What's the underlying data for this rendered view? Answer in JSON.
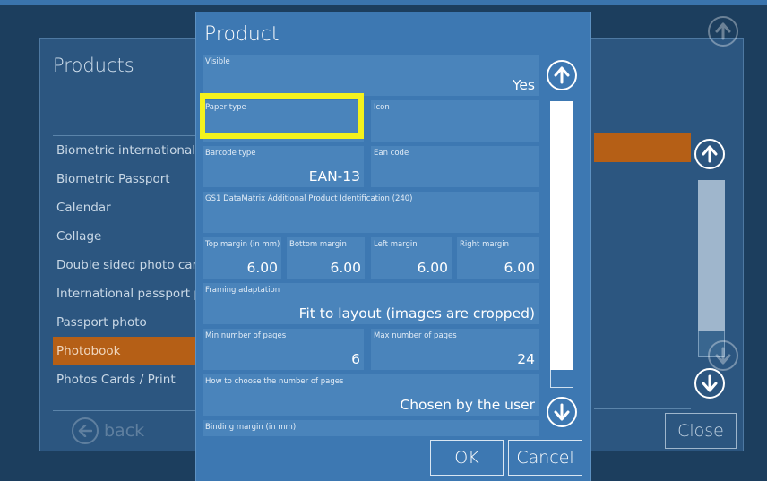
{
  "background": {
    "title": "Products",
    "items": [
      {
        "label": "Biometric international passport"
      },
      {
        "label": "Biometric Passport"
      },
      {
        "label": "Calendar"
      },
      {
        "label": "Collage"
      },
      {
        "label": "Double sided photo card"
      },
      {
        "label": "International passport photo"
      },
      {
        "label": "Passport photo"
      },
      {
        "label": "Photobook"
      },
      {
        "label": "Photos Cards / Print"
      }
    ],
    "selected_item": "Photobook",
    "close_label": "Close",
    "back_label": "back"
  },
  "dialog": {
    "title": "Product",
    "fields": {
      "visible": {
        "label": "Visible",
        "value": "Yes"
      },
      "paper_type": {
        "label": "Paper type",
        "value": ""
      },
      "icon": {
        "label": "Icon",
        "value": ""
      },
      "barcode_type": {
        "label": "Barcode type",
        "value": "EAN-13"
      },
      "ean_code": {
        "label": "Ean code",
        "value": ""
      },
      "gs1": {
        "label": "GS1 DataMatrix Additional Product Identification (240)",
        "value": ""
      },
      "top_margin": {
        "label": "Top margin (in mm)",
        "value": "6.00"
      },
      "bottom_margin": {
        "label": "Bottom margin",
        "value": "6.00"
      },
      "left_margin": {
        "label": "Left margin",
        "value": "6.00"
      },
      "right_margin": {
        "label": "Right margin",
        "value": "6.00"
      },
      "framing": {
        "label": "Framing adaptation",
        "value": "Fit to layout (images are cropped)"
      },
      "min_pages": {
        "label": "Min number of pages",
        "value": "6"
      },
      "max_pages": {
        "label": "Max number of pages",
        "value": "24"
      },
      "choose_pages": {
        "label": "How to choose the number of pages",
        "value": "Chosen by the user"
      },
      "binding_margin": {
        "label": "Binding margin (in mm)",
        "value": ""
      }
    },
    "ok_label": "OK",
    "cancel_label": "Cancel"
  },
  "colors": {
    "dialog_bg": "#3d78b2",
    "field_bg": "#4a84bb",
    "selection_orange": "#b55f16",
    "highlight_yellow": "#f4f21d"
  },
  "icons": {
    "scroll_up": "arrow-up-circle-icon",
    "scroll_down": "arrow-down-circle-icon",
    "back": "arrow-left-circle-icon"
  }
}
